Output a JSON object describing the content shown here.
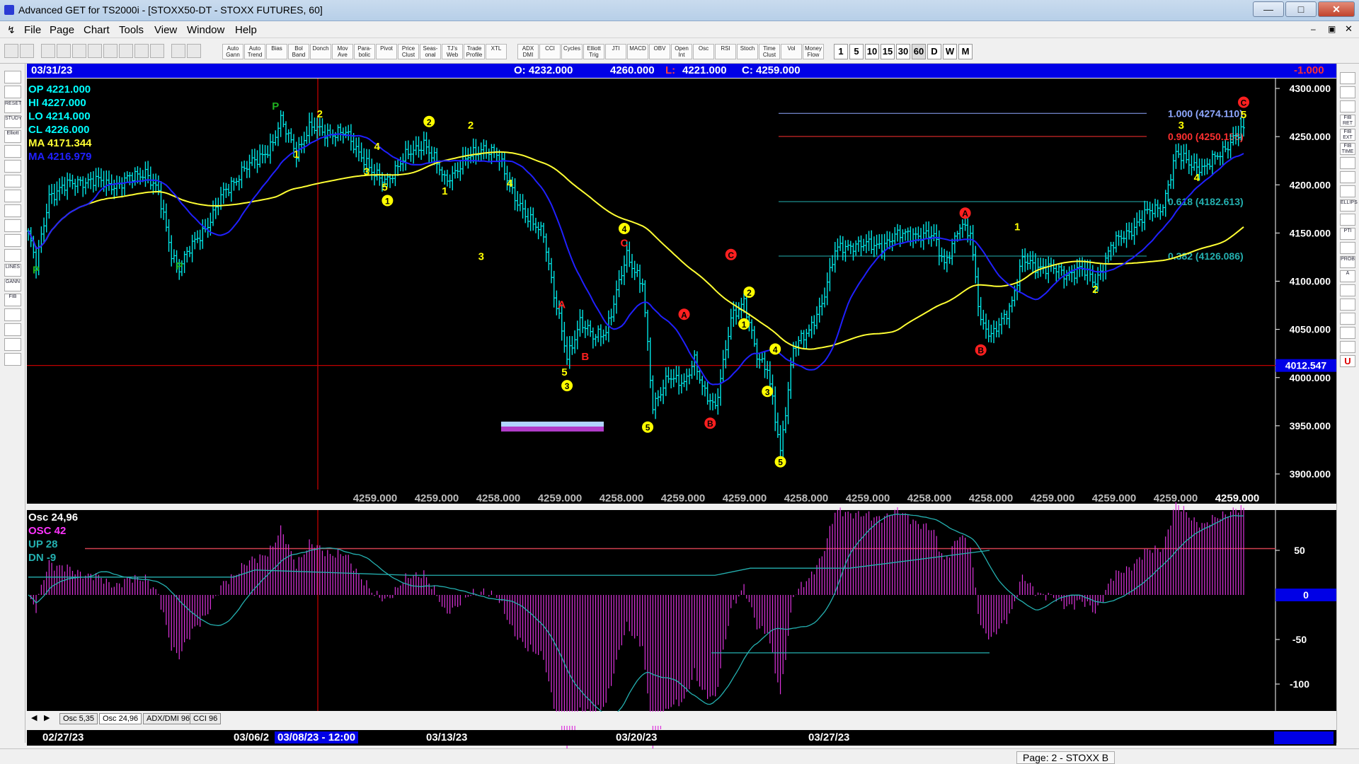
{
  "window": {
    "title": "Advanced GET for TS2000i - [STOXX50-DT - STOXX FUTURES, 60]"
  },
  "menu": [
    "File",
    "Page",
    "Chart",
    "Tools",
    "View",
    "Window",
    "Help"
  ],
  "toolbar": {
    "buttons": [
      "Auto Gann",
      "Auto Trend",
      "Bias",
      "Bol Band",
      "Donch",
      "Mov Ave",
      "Para- bolic",
      "Pivot",
      "Price Clust",
      "Seas- onal",
      "TJ's Web",
      "Trade Profile",
      "XTL",
      "ADX DMI",
      "CCI",
      "Cycles",
      "Elliott Trig",
      "JTI",
      "MACD",
      "OBV",
      "Open Int",
      "Osc",
      "RSI",
      "Stoch",
      "Time Clust",
      "Vol",
      "Money Flow"
    ],
    "timeframes": [
      "1",
      "5",
      "10",
      "15",
      "30",
      "60",
      "D",
      "W",
      "M"
    ]
  },
  "left_tools": [
    "",
    "",
    "RESET",
    "STUDY",
    "Elliott",
    "",
    "",
    "",
    "",
    "",
    "",
    "",
    "",
    "LINES",
    "GANN",
    "FIB",
    "",
    "",
    "",
    ""
  ],
  "right_tools": [
    "",
    "",
    "",
    "FIB RET",
    "FIB EXT",
    "FIB TIME",
    "",
    "",
    "",
    "ELLIPS",
    "",
    "PTI",
    "",
    "PROB",
    "A",
    "",
    "",
    "",
    "",
    "",
    "U"
  ],
  "infobar": {
    "date": "03/31/23",
    "open": "O: 4232.000",
    "high": "4260.000",
    "low_label": "L:",
    "low": "4221.000",
    "close": "C: 4259.000",
    "change": "-1.000"
  },
  "price_panel": {
    "legend": [
      {
        "label": "OP",
        "value": "4221.000",
        "color": "#00ffff"
      },
      {
        "label": "HI",
        "value": "4227.000",
        "color": "#00ffff"
      },
      {
        "label": "LO",
        "value": "4214.000",
        "color": "#00ffff"
      },
      {
        "label": "CL",
        "value": "4226.000",
        "color": "#00ffff"
      },
      {
        "label": "MA",
        "value": "4171.344",
        "color": "#ffff33"
      },
      {
        "label": "MA",
        "value": "4216.979",
        "color": "#2020ff"
      }
    ],
    "cursor_price": "4012.547",
    "pivot_row": [
      "4259.000",
      "4259.000",
      "4258.000",
      "4259.000",
      "4258.000",
      "4259.000",
      "4259.000",
      "4258.000",
      "4259.000",
      "4258.000",
      "4258.000",
      "4259.000",
      "4259.000",
      "4259.000"
    ],
    "pivot_last": "4259.000",
    "fib_levels": [
      {
        "label": "1.000 (4274.110)",
        "price": 4274.11,
        "color": "#8fa8ff"
      },
      {
        "label": "0.900 (4250.158)",
        "price": 4250.158,
        "color": "#ff3030"
      },
      {
        "label": "0.618 (4182.613)",
        "price": 4182.613,
        "color": "#24b0b0"
      },
      {
        "label": "0.382 (4126.086)",
        "price": 4126.086,
        "color": "#24b0b0"
      }
    ],
    "wave_labels": [
      {
        "t": "P",
        "i": 3,
        "p": 4108,
        "c": "#1fb21f"
      },
      {
        "t": "P",
        "i": 58,
        "p": 4112,
        "c": "#1fb21f"
      },
      {
        "t": "P",
        "i": 95,
        "p": 4278,
        "c": "#1fb21f"
      },
      {
        "t": "2",
        "i": 112,
        "p": 4270,
        "c": "#ffff00"
      },
      {
        "t": "1",
        "i": 103,
        "p": 4228,
        "c": "#ffff00"
      },
      {
        "t": "4",
        "i": 134,
        "p": 4236,
        "c": "#ffff00"
      },
      {
        "t": "3",
        "i": 130,
        "p": 4210,
        "c": "#ffff00"
      },
      {
        "t": "5",
        "i": 137,
        "p": 4194,
        "c": "#ffff00"
      },
      {
        "t": "1",
        "i": 138,
        "p": 4180,
        "c": "#ffff00",
        "circle": true
      },
      {
        "t": "2",
        "i": 154,
        "p": 4262,
        "c": "#ffff00",
        "circle": true
      },
      {
        "t": "1",
        "i": 160,
        "p": 4190,
        "c": "#ffff00"
      },
      {
        "t": "2",
        "i": 170,
        "p": 4258,
        "c": "#ffff00"
      },
      {
        "t": "4",
        "i": 185,
        "p": 4198,
        "c": "#ffff00"
      },
      {
        "t": "3",
        "i": 174,
        "p": 4122,
        "c": "#ffff00"
      },
      {
        "t": "A",
        "i": 205,
        "p": 4072,
        "c": "#ff2020"
      },
      {
        "t": "B",
        "i": 214,
        "p": 4018,
        "c": "#ff2020"
      },
      {
        "t": "5",
        "i": 206,
        "p": 4002,
        "c": "#ffff00"
      },
      {
        "t": "3",
        "i": 207,
        "p": 3988,
        "c": "#ffff00",
        "circle": true
      },
      {
        "t": "4",
        "i": 229,
        "p": 4151,
        "c": "#ffff00",
        "circle": true
      },
      {
        "t": "C",
        "i": 229,
        "p": 4136,
        "c": "#ff2020"
      },
      {
        "t": "5",
        "i": 238,
        "p": 3945,
        "c": "#ffff00",
        "circle": true
      },
      {
        "t": "A",
        "i": 252,
        "p": 4062,
        "c": "#ff2020",
        "circle": true
      },
      {
        "t": "B",
        "i": 262,
        "p": 3949,
        "c": "#ff2020",
        "circle": true
      },
      {
        "t": "C",
        "i": 270,
        "p": 4124,
        "c": "#ff2020",
        "circle": true
      },
      {
        "t": "2",
        "i": 277,
        "p": 4085,
        "c": "#ffff00",
        "circle": true
      },
      {
        "t": "1",
        "i": 275,
        "p": 4052,
        "c": "#ffff00",
        "circle": true
      },
      {
        "t": "4",
        "i": 287,
        "p": 4026,
        "c": "#ffff00",
        "circle": true
      },
      {
        "t": "3",
        "i": 284,
        "p": 3982,
        "c": "#ffff00",
        "circle": true
      },
      {
        "t": "5",
        "i": 289,
        "p": 3909,
        "c": "#ffff00",
        "circle": true
      },
      {
        "t": "A",
        "i": 360,
        "p": 4167,
        "c": "#ff2020",
        "circle": true
      },
      {
        "t": "B",
        "i": 366,
        "p": 4025,
        "c": "#ff2020",
        "circle": true
      },
      {
        "t": "1",
        "i": 380,
        "p": 4153,
        "c": "#ffff00"
      },
      {
        "t": "2",
        "i": 410,
        "p": 4088,
        "c": "#ffff00"
      },
      {
        "t": "3",
        "i": 443,
        "p": 4258,
        "c": "#ffff00"
      },
      {
        "t": "4",
        "i": 449,
        "p": 4204,
        "c": "#ffff00"
      },
      {
        "t": "5",
        "i": 467,
        "p": 4269,
        "c": "#ffff00"
      },
      {
        "t": "C",
        "i": 467,
        "p": 4282,
        "c": "#ff2020",
        "circle": true
      }
    ]
  },
  "osc_panel": {
    "legend": [
      {
        "label": "Osc 24,96",
        "color": "#ffffff"
      },
      {
        "label": "OSC 42",
        "color": "#ff33ff"
      },
      {
        "label": "UP   28",
        "color": "#24b0b0"
      },
      {
        "label": "DN   -9",
        "color": "#24b0b0"
      }
    ],
    "zero_label": "0"
  },
  "price_axis": {
    "ticks": [
      "4300.000",
      "4250.000",
      "4200.000",
      "4150.000",
      "4100.000",
      "4050.000",
      "4000.000",
      "3950.000",
      "3900.000"
    ]
  },
  "osc_axis": {
    "ticks": [
      "50",
      "-50",
      "-100"
    ]
  },
  "bottom_tabs": [
    "Osc 5,35",
    "Osc 24,96",
    "ADX/DMI 96",
    "CCI 96"
  ],
  "time_axis": {
    "labels": [
      "02/27/23",
      "03/06/2",
      "03/13/23",
      "03/20/23",
      "03/27/23"
    ],
    "cursor_label": "03/08/23 - 12:00"
  },
  "status": "Page: 2 - STOXX B",
  "colors": {
    "background": "#000000",
    "candle": "#00e6e6",
    "ma_yellow": "#ffff33",
    "ma_blue": "#2020ff",
    "osc_bars": "#dd33dd",
    "cursor": "#c00000",
    "infobar": "#0000e6"
  }
}
